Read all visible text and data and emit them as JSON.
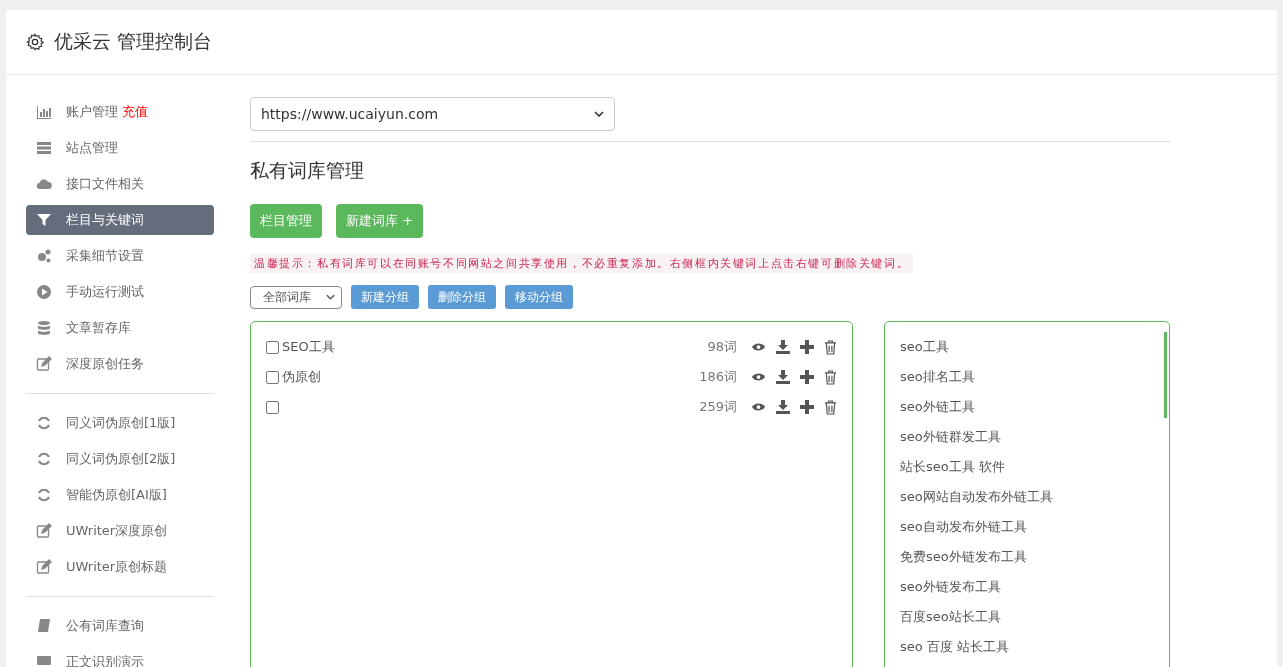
{
  "header": {
    "title": "优采云 管理控制台"
  },
  "sidebar": {
    "groups": [
      [
        {
          "label": "账户管理",
          "badge": "充值",
          "selected": false
        },
        {
          "label": "站点管理",
          "selected": false
        },
        {
          "label": "接口文件相关",
          "selected": false
        },
        {
          "label": "栏目与关键词",
          "selected": true
        },
        {
          "label": "采集细节设置",
          "selected": false
        },
        {
          "label": "手动运行测试",
          "selected": false
        },
        {
          "label": "文章暂存库",
          "selected": false
        },
        {
          "label": "深度原创任务",
          "selected": false
        }
      ],
      [
        {
          "label": "同义词伪原创[1版]",
          "selected": false
        },
        {
          "label": "同义词伪原创[2版]",
          "selected": false
        },
        {
          "label": "智能伪原创[AI版]",
          "selected": false
        },
        {
          "label": "UWriter深度原创",
          "selected": false
        },
        {
          "label": "UWriter原创标题",
          "selected": false
        }
      ],
      [
        {
          "label": "公有词库查询",
          "selected": false
        },
        {
          "label": "正文识别演示",
          "selected": false
        }
      ]
    ]
  },
  "site_select": {
    "value": "https://www.ucaiyun.com"
  },
  "heading": "私有词库管理",
  "buttons": [
    "栏目管理",
    "新建词库 +"
  ],
  "hint": "温馨提示：私有词库可以在同账号不同网站之间共享使用，不必重复添加。右侧框内关键词上点击右键可删除关键词。",
  "filter_select": {
    "value": "全部词库"
  },
  "group_buttons": [
    "新建分组",
    "删除分组",
    "移动分组"
  ],
  "libraries": [
    {
      "name": "SEO工具",
      "count": "98词",
      "checked": false
    },
    {
      "name": "伪原创",
      "count": "186词",
      "checked": false
    },
    {
      "count": "259词",
      "checked": false
    }
  ],
  "keywords": [
    "seo工具",
    "seo排名工具",
    "seo外链工具",
    "seo外链群发工具",
    "站长seo工具 软件",
    "seo网站自动发布外链工具",
    "seo自动发布外链工具",
    "免费seo外链发布工具",
    "seo外链发布工具",
    "百度seo站长工具",
    "seo 百度 站长工具"
  ]
}
